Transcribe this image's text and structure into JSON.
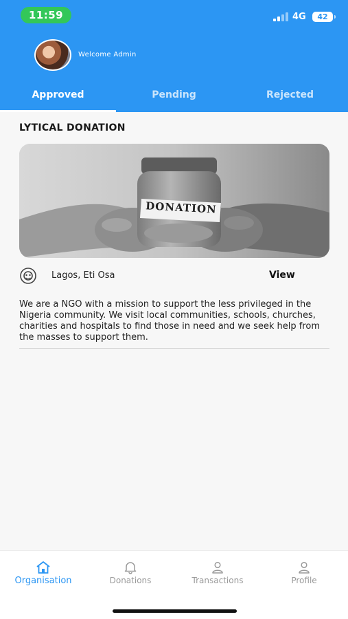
{
  "status_bar": {
    "time": "11:59",
    "network": "4G",
    "battery": "42",
    "colors": {
      "time_pill": "#33c759"
    }
  },
  "header": {
    "welcome": "Welcome  Admin",
    "avatar_icon": "user-avatar-photo"
  },
  "tabs": [
    {
      "label": "Approved",
      "active": true
    },
    {
      "label": "Pending",
      "active": false
    },
    {
      "label": "Rejected",
      "active": false
    }
  ],
  "organisation": {
    "title": "LYTICAL DONATION",
    "image_label": "DONATION",
    "location": "Lagos, Eti Osa",
    "location_icon": "organisation-badge-icon",
    "view_label": "View",
    "description": "We are a NGO with a mission to support the less privileged in the Nigeria community. We visit local communities, schools, churches, charities and hospitals to find those in need and we seek help from the masses to support them."
  },
  "bottom_nav": [
    {
      "label": "Organisation",
      "icon": "home-icon",
      "active": true
    },
    {
      "label": "Donations",
      "icon": "bell-icon",
      "active": false
    },
    {
      "label": "Transactions",
      "icon": "person-icon",
      "active": false
    },
    {
      "label": "Profile",
      "icon": "person-icon",
      "active": false
    }
  ],
  "colors": {
    "primary": "#2c96f3",
    "background": "#f7f7f7",
    "inactive_nav": "#9a9a9a"
  }
}
